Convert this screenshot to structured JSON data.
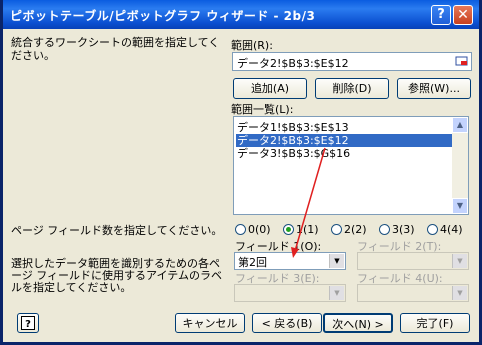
{
  "window": {
    "title": "ピボットテーブル/ピボットグラフ ウィザード - 2b/3",
    "help_glyph": "?",
    "close_glyph": "✕"
  },
  "range_prompt": "統合するワークシートの範囲を指定してください。",
  "range": {
    "label": "範囲(R):",
    "value": "データ2!$B$3:$E$12"
  },
  "buttons": {
    "add": "追加(A)",
    "delete": "削除(D)",
    "browse": "参照(W)...",
    "cancel": "キャンセル",
    "back": "< 戻る(B)",
    "next": "次へ(N) >",
    "finish": "完了(F)"
  },
  "range_list": {
    "label": "範囲一覧(L):",
    "items": [
      "データ1!$B$3:$E$13",
      "データ2!$B$3:$E$12",
      "データ3!$B$3:$G$16"
    ],
    "selected_index": 1
  },
  "page_field_prompt": "ページ フィールド数を指定してください。",
  "page_field_options": [
    {
      "label": "0(0)",
      "checked": false
    },
    {
      "label": "1(1)",
      "checked": true
    },
    {
      "label": "2(2)",
      "checked": false
    },
    {
      "label": "3(3)",
      "checked": false
    },
    {
      "label": "4(4)",
      "checked": false
    }
  ],
  "item_label_prompt": "選択したデータ範囲を識別するための各ページ フィールドに使用するアイテムのラベルを指定してください。",
  "fields": [
    {
      "label": "フィールド 1(O):",
      "value": "第2回",
      "enabled": true
    },
    {
      "label": "フィールド 2(T):",
      "value": "",
      "enabled": false
    },
    {
      "label": "フィールド 3(E):",
      "value": "",
      "enabled": false
    },
    {
      "label": "フィールド 4(U):",
      "value": "",
      "enabled": false
    }
  ],
  "colors": {
    "title_bar": "#0a5ce0",
    "dialog_bg": "#ece9d8",
    "selection": "#316ac5",
    "annotation_arrow": "#e02020"
  }
}
